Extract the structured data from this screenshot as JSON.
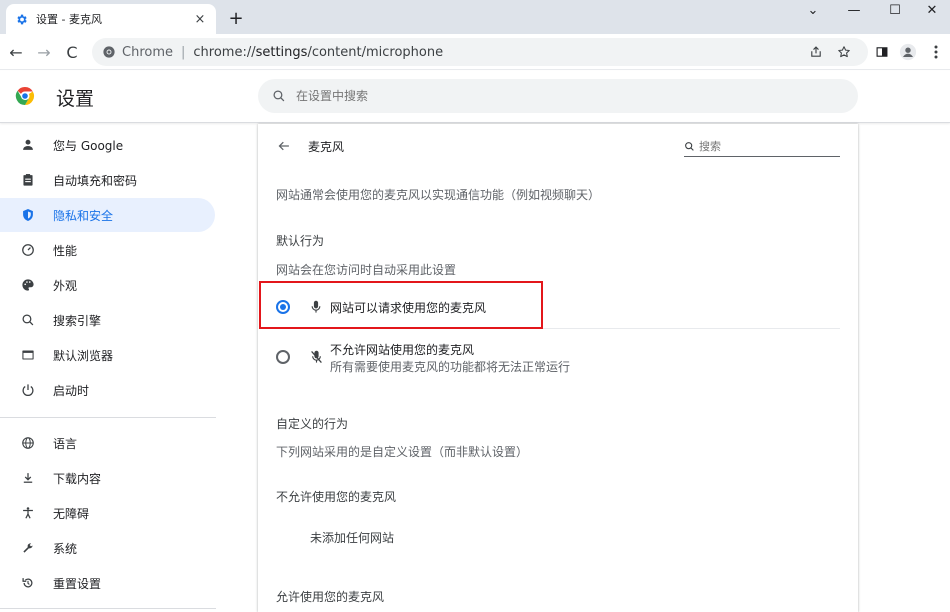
{
  "tab": {
    "title": "设置 - 麦克风",
    "close": "×",
    "favicon": "gear-icon"
  },
  "newtab": "+",
  "window": {
    "minimize": "—",
    "maximize": "☐",
    "close": "✕",
    "dropdown": "⌄"
  },
  "toolbar": {
    "back": "←",
    "forward": "→",
    "reload": "C"
  },
  "omnibox": {
    "chip_label": "Chrome",
    "separator": "|",
    "url_prefix": "chrome://",
    "url_host": "settings",
    "url_path": "/content/microphone"
  },
  "header": {
    "title": "设置",
    "search_placeholder": "在设置中搜索"
  },
  "sidebar": {
    "items": [
      {
        "label": "您与 Google",
        "icon": "person-icon"
      },
      {
        "label": "自动填充和密码",
        "icon": "clipboard-icon"
      },
      {
        "label": "隐私和安全",
        "icon": "shield-icon",
        "active": true
      },
      {
        "label": "性能",
        "icon": "speedometer-icon"
      },
      {
        "label": "外观",
        "icon": "palette-icon"
      },
      {
        "label": "搜索引擎",
        "icon": "search-icon"
      },
      {
        "label": "默认浏览器",
        "icon": "browser-icon"
      },
      {
        "label": "启动时",
        "icon": "power-icon"
      },
      {
        "label": "语言",
        "icon": "globe-icon"
      },
      {
        "label": "下载内容",
        "icon": "download-icon"
      },
      {
        "label": "无障碍",
        "icon": "accessibility-icon"
      },
      {
        "label": "系统",
        "icon": "wrench-icon"
      },
      {
        "label": "重置设置",
        "icon": "reset-icon"
      }
    ]
  },
  "content": {
    "title": "麦克风",
    "search_placeholder": "搜索",
    "description": "网站通常会使用您的麦克风以实现通信功能（例如视频聊天）",
    "default_behavior_heading": "默认行为",
    "default_behavior_sub": "网站会在您访问时自动采用此设置",
    "option_allow": "网站可以请求使用您的麦克风",
    "option_block_title": "不允许网站使用您的麦克风",
    "option_block_sub": "所有需要使用麦克风的功能都将无法正常运行",
    "selected_option": "allow",
    "custom_heading": "自定义的行为",
    "custom_sub": "下列网站采用的是自定义设置（而非默认设置）",
    "blocked_heading": "不允许使用您的麦克风",
    "blocked_empty": "未添加任何网站",
    "allowed_heading": "允许使用您的麦克风"
  },
  "colors": {
    "accent": "#1a73e8",
    "highlight_border": "#e3161b",
    "active_nav_bg": "#e8f0fe"
  }
}
